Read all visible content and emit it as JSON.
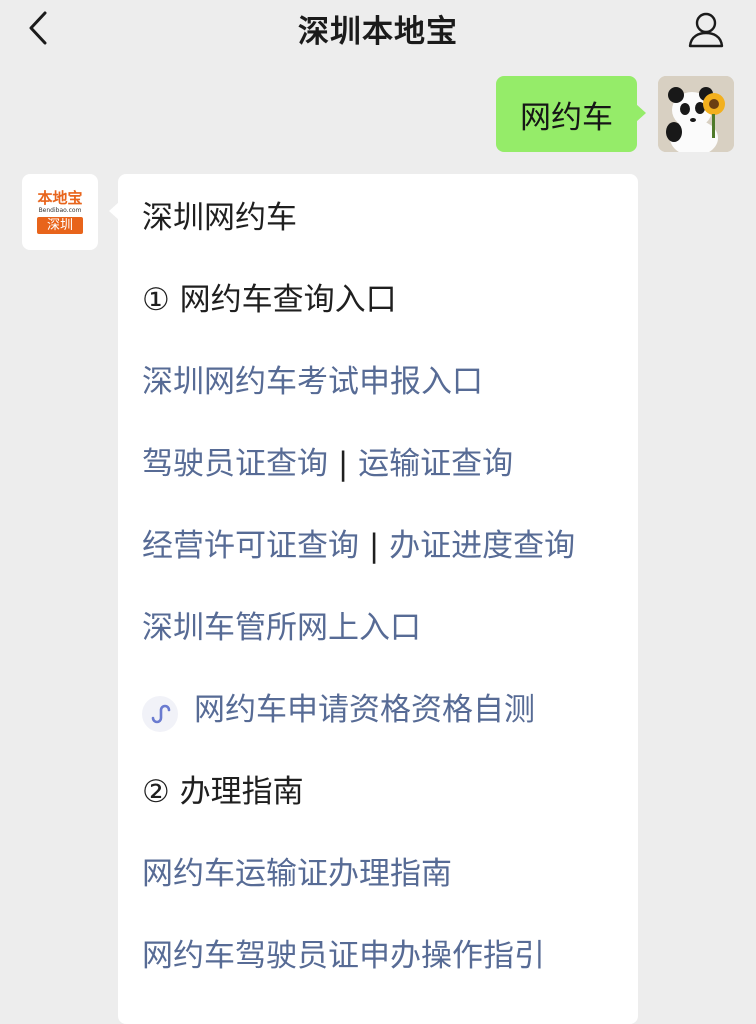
{
  "header": {
    "title": "深圳本地宝",
    "back_icon": "chevron-left-icon",
    "profile_icon": "person-icon"
  },
  "sent_message": {
    "text": "网约车"
  },
  "bot_avatar": {
    "brand": "本地宝",
    "url": "Bendibao.com",
    "city": "深圳"
  },
  "reply": {
    "heading": "深圳网约车",
    "section1": "① 网约车查询入口",
    "link_exam": "深圳网约车考试申报入口",
    "link_driver_cert": "驾驶员证查询",
    "link_transport_cert": "运输证查询",
    "link_license": "经营许可证查询",
    "link_progress": "办证进度查询",
    "separator": "|",
    "link_dmv": "深圳车管所网上入口",
    "link_miniapp": "网约车申请资格资格自测",
    "miniapp_icon": "mini-program-icon",
    "section2": "② 办理指南",
    "link_transport_guide": "网约车运输证办理指南",
    "link_driver_guide": "网约车驾驶员证申办操作指引"
  },
  "colors": {
    "background": "#ededed",
    "sent_bubble": "#95ec69",
    "link": "#576b95",
    "brand_orange": "#e8641b"
  }
}
